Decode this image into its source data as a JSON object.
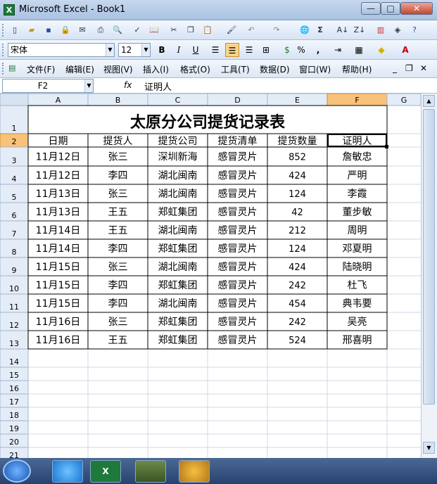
{
  "window": {
    "title": "Microsoft Excel - Book1",
    "app_icon": "X"
  },
  "font_box": {
    "name": "宋体",
    "size": "12"
  },
  "menu": [
    "文件(F)",
    "编辑(E)",
    "视图(V)",
    "插入(I)",
    "格式(O)",
    "工具(T)",
    "数据(D)",
    "窗口(W)",
    "帮助(H)"
  ],
  "formula_bar": {
    "name_box": "F2",
    "fx": "fx",
    "value": "证明人"
  },
  "columns": [
    "A",
    "B",
    "C",
    "D",
    "E",
    "F",
    "G"
  ],
  "rows": [
    "1",
    "2",
    "3",
    "4",
    "5",
    "6",
    "7",
    "8",
    "9",
    "10",
    "11",
    "12",
    "13",
    "14",
    "15",
    "16",
    "17",
    "18",
    "19",
    "20",
    "21"
  ],
  "sheet_title": "太原分公司提货记录表",
  "table_headers": [
    "日期",
    "提货人",
    "提货公司",
    "提货清单",
    "提货数量",
    "证明人"
  ],
  "table_rows": [
    [
      "11月12日",
      "张三",
      "深圳新海",
      "感冒灵片",
      "852",
      "詹敏忠"
    ],
    [
      "11月12日",
      "李四",
      "湖北闽南",
      "感冒灵片",
      "424",
      "严明"
    ],
    [
      "11月13日",
      "张三",
      "湖北闽南",
      "感冒灵片",
      "124",
      "李霞"
    ],
    [
      "11月13日",
      "王五",
      "郑虹集团",
      "感冒灵片",
      "42",
      "董步敏"
    ],
    [
      "11月14日",
      "王五",
      "湖北闽南",
      "感冒灵片",
      "212",
      "周明"
    ],
    [
      "11月14日",
      "李四",
      "郑虹集团",
      "感冒灵片",
      "124",
      "邓夏明"
    ],
    [
      "11月15日",
      "张三",
      "湖北闽南",
      "感冒灵片",
      "424",
      "陆晓明"
    ],
    [
      "11月15日",
      "李四",
      "郑虹集团",
      "感冒灵片",
      "242",
      "杜飞"
    ],
    [
      "11月15日",
      "李四",
      "湖北闽南",
      "感冒灵片",
      "454",
      "典韦要"
    ],
    [
      "11月16日",
      "张三",
      "郑虹集团",
      "感冒灵片",
      "242",
      "吴亮"
    ],
    [
      "11月16日",
      "王五",
      "郑虹集团",
      "感冒灵片",
      "524",
      "邢喜明"
    ]
  ],
  "colors": {
    "selected_header": "#f8c27a",
    "header_bg": "#e4ecf7",
    "grid_line": "#d0d7e5"
  }
}
